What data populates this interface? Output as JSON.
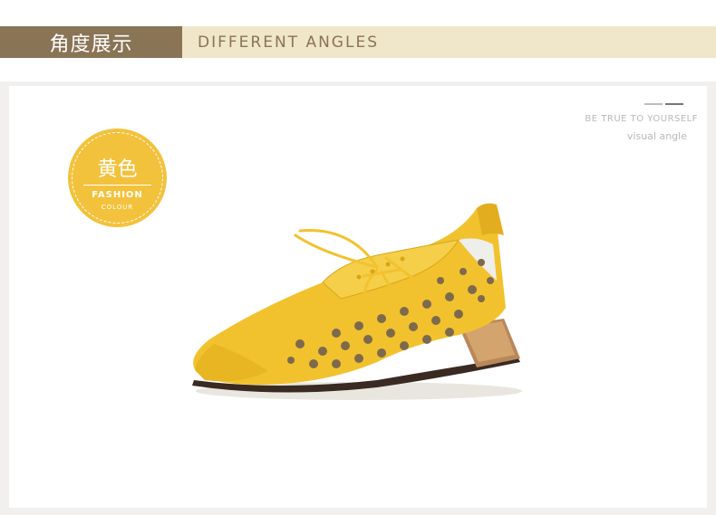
{
  "header": {
    "title_cn": "角度展示",
    "title_en": "DIFFERENT ANGLES"
  },
  "panel": {
    "tagline": "BE TRUE TO YOURSELF",
    "subline": "visual angle"
  },
  "badge": {
    "color_name": "黄色",
    "line1": "FASHION",
    "line2": "COLOUR"
  },
  "product": {
    "image_icon": "yellow-perforated-shoe",
    "colors": {
      "leather": "#f2c22e",
      "leather_shade": "#d9a514",
      "heel_bronze": "#b8885a",
      "sole": "#3a2b22"
    }
  },
  "theme": {
    "brown": "#8a7456",
    "cream": "#f0e6c9",
    "badge_yellow": "#f3c23c"
  }
}
